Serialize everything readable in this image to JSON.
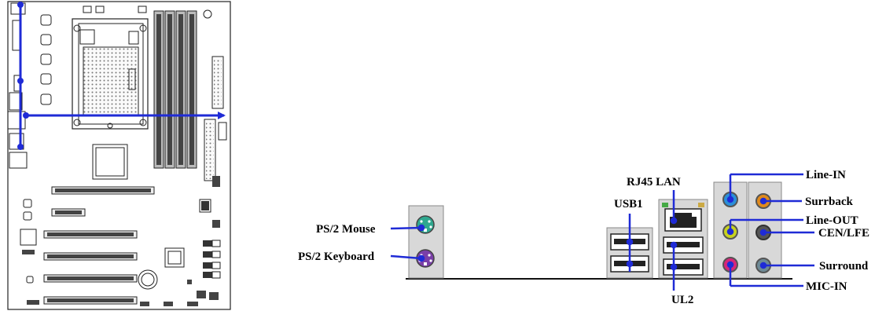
{
  "labels": {
    "ps2_mouse": "PS/2 Mouse",
    "ps2_keyboard": "PS/2 Keyboard",
    "usb1": "USB1",
    "rj45_lan": "RJ45 LAN",
    "ul2": "UL2",
    "line_in": "Line-IN",
    "surrback": "Surrback",
    "line_out": "Line-OUT",
    "cen_lfe": "CEN/LFE",
    "surround": "Surround",
    "mic_in": "MIC-IN"
  },
  "colors": {
    "pointer": "#1f2bd6",
    "mouse_port": "#2fa88f",
    "keyboard_port": "#7a3fa8",
    "line_in_jack": "#2a8fd8",
    "surrback_jack": "#e08a1c",
    "line_out_jack": "#c8d21f",
    "cen_lfe_jack": "#222222",
    "surround_jack": "#6e8a96",
    "mic_in_jack": "#d8267a",
    "panel": "#d8d8d8"
  }
}
